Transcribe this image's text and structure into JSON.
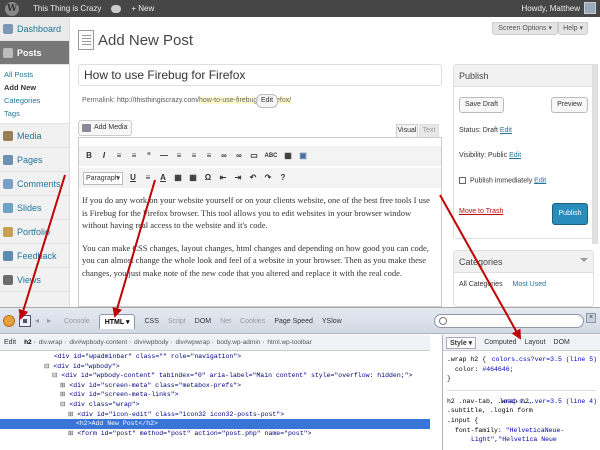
{
  "adminbar": {
    "site_name": "This Thing is Crazy",
    "new_label": "New",
    "howdy": "Howdy, Matthew"
  },
  "menu": {
    "items": [
      {
        "label": "Dashboard",
        "color": "#7b98b6"
      },
      {
        "label": "Posts",
        "color": "#888888"
      },
      {
        "label": "Media",
        "color": "#9a7e5a"
      },
      {
        "label": "Pages",
        "color": "#6b8fb3"
      },
      {
        "label": "Comments",
        "color": "#7aa0c4"
      },
      {
        "label": "Slides",
        "color": "#6ea3c1"
      },
      {
        "label": "Portfolio",
        "color": "#c8a050"
      },
      {
        "label": "Feedback",
        "color": "#5e8ab0"
      },
      {
        "label": "Views",
        "color": "#6d6d6d"
      }
    ],
    "posts_sub": [
      "All Posts",
      "Add New",
      "Categories",
      "Tags"
    ]
  },
  "header": {
    "screen_options": "Screen Options ▾",
    "help": "Help ▾",
    "page_title": "Add New Post"
  },
  "editor": {
    "title_value": "How to use Firebug for Firefox",
    "permalink_label": "Permalink:",
    "permalink_url": "http://thisthingiscrazy.com/",
    "permalink_slug": "how-to-use-firebug-for-firefox/",
    "edit_label": "Edit",
    "add_media": "Add Media",
    "tab_visual": "Visual",
    "tab_text": "Text",
    "format_value": "Paragraph",
    "toolbar1": [
      "B",
      "I",
      "≡",
      "≡",
      "“",
      "—",
      "≡",
      "≡",
      "≡",
      "∞",
      "∞",
      "▭",
      "ABC",
      "▦",
      "▣"
    ],
    "toolbar2": [
      "U",
      "≡",
      "A",
      "▦",
      "▦",
      "Ω",
      "⇤",
      "⇥",
      "↶",
      "↷",
      "?"
    ],
    "paragraph1": "If you do any work on your website yourself or on your clients website, one of the best free tools I use is Firebug for the Firefox browser.  This tool allows you to edit websites in your browser window without having real access to the website and it's code.",
    "paragraph2": "You can make CSS changes, layout changes, html changes and depending on how good you can code, you can almost change the whole look and feel of a website in your browser.  Then as you make these changes, you just make note of the new code that you altered and replace it with the real code."
  },
  "publish": {
    "heading": "Publish",
    "save_draft": "Save Draft",
    "preview": "Preview",
    "status_label": "Status: Draft",
    "status_edit": "Edit",
    "visibility_label": "Visibility: Public",
    "visibility_edit": "Edit",
    "schedule_label": "Publish immediately",
    "schedule_edit": "Edit",
    "trash": "Move to Trash",
    "publish": "Publish"
  },
  "categories": {
    "heading": "Categories",
    "tab_all": "All Categories",
    "tab_most": "Most Used"
  },
  "firebug": {
    "tabs": [
      "Console",
      "HTML ▾",
      "CSS",
      "Script",
      "DOM",
      "Net",
      "Cookies",
      "Page Speed",
      "YSlow"
    ],
    "edit_label": "Edit",
    "breadcrumbs": [
      "h2",
      "div.wrap",
      "div#wpbody-content",
      "div#wpbody",
      "div#wpwrap",
      "body.wp-admin",
      "html.wp-toolbar"
    ],
    "html_lines": [
      {
        "toggle": "",
        "text": "<div id=\"wpadminbar\" class=\"\" role=\"navigation\">"
      },
      {
        "toggle": "⊟",
        "text": "<div id=\"wpbody\">"
      },
      {
        "toggle": "⊟",
        "text": "<div id=\"wpbody-content\" tabindex=\"0\" aria-label=\"Main content\" style=\"overflow: hidden;\">"
      },
      {
        "toggle": "⊞",
        "text": "<div id=\"screen-meta\" class=\"metabox-prefs\">"
      },
      {
        "toggle": "⊞",
        "text": "<div id=\"screen-meta-links\">"
      },
      {
        "toggle": "⊟",
        "text": "<div class=\"wrap\">"
      },
      {
        "toggle": "⊞",
        "text": "<div id=\"icon-edit\" class=\"icon32 icon32-posts-post\">"
      },
      {
        "toggle": "",
        "text": "<h2>Add New Post</h2>"
      },
      {
        "toggle": "⊞",
        "text": "<form id=\"post\" method=\"post\" action=\"post.php\" name=\"post\">"
      }
    ],
    "side_tabs": [
      "Style ▾",
      "Computed",
      "Layout",
      "DOM"
    ],
    "css_rules": [
      {
        "selector": ".wrap h2 {",
        "source": "colors.css?ver=3.5 (line 5)"
      },
      {
        "prop": "color:",
        "value": "#464646;"
      },
      {
        "selector": "}",
        "source": ""
      },
      {
        "selector": "h2 .nav-tab, .wrap h2,",
        "source": "load-s...ver=3.5 (line 4)"
      },
      {
        "selector": ".subtitle, .login form",
        "source": ""
      },
      {
        "selector": ".input {",
        "source": ""
      },
      {
        "prop": "font-family:",
        "value": "\"HelveticaNeue-"
      },
      {
        "prop": "",
        "value": "Light\",\"Helvetica Neue"
      }
    ]
  },
  "colors": {
    "admin_bar": "#464646",
    "link": "#21759b",
    "publish_button": "#298cba",
    "selected_row": "#3875d7",
    "arrows": "#c00000"
  }
}
